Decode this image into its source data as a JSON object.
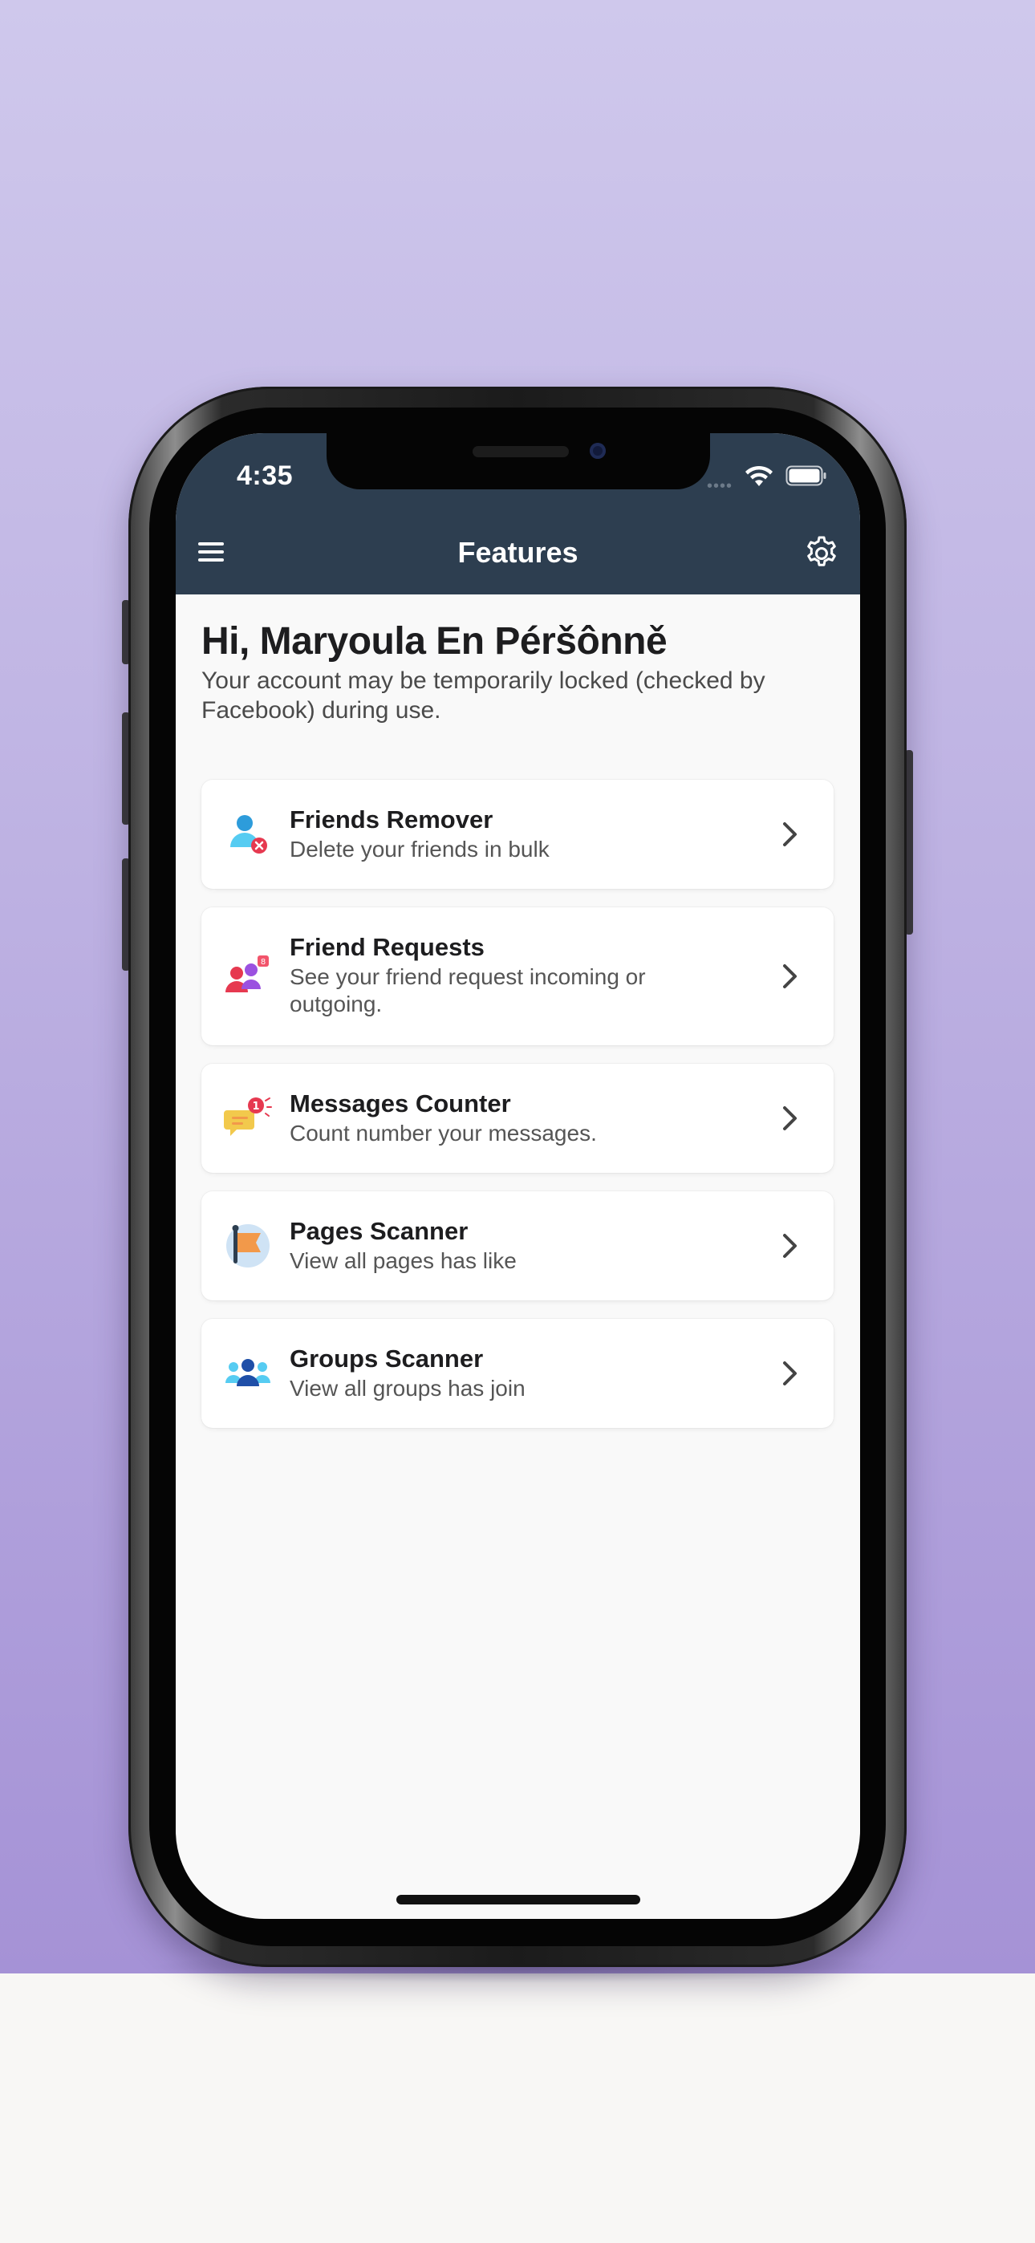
{
  "status_bar": {
    "time": "4:35",
    "signal_dots": "••••"
  },
  "nav": {
    "title": "Features"
  },
  "greeting": "Hi, Maryoula En Péršônně",
  "notice": "Your account may be temporarily locked (checked by Facebook) during use.",
  "features": [
    {
      "title": "Friends Remover",
      "subtitle": "Delete your friends in bulk",
      "icon": "friends-remover-icon"
    },
    {
      "title": "Friend Requests",
      "subtitle": "See your friend request incoming or outgoing.",
      "icon": "friend-requests-icon"
    },
    {
      "title": "Messages Counter",
      "subtitle": "Count number your messages.",
      "icon": "messages-counter-icon"
    },
    {
      "title": "Pages Scanner",
      "subtitle": "View all pages has like",
      "icon": "pages-scanner-icon"
    },
    {
      "title": "Groups Scanner",
      "subtitle": "View all groups has join",
      "icon": "groups-scanner-icon"
    }
  ],
  "colors": {
    "header": "#2d3e50",
    "background": "#f9f9f9",
    "card": "#ffffff",
    "backdrop": "#bdb1e2"
  }
}
